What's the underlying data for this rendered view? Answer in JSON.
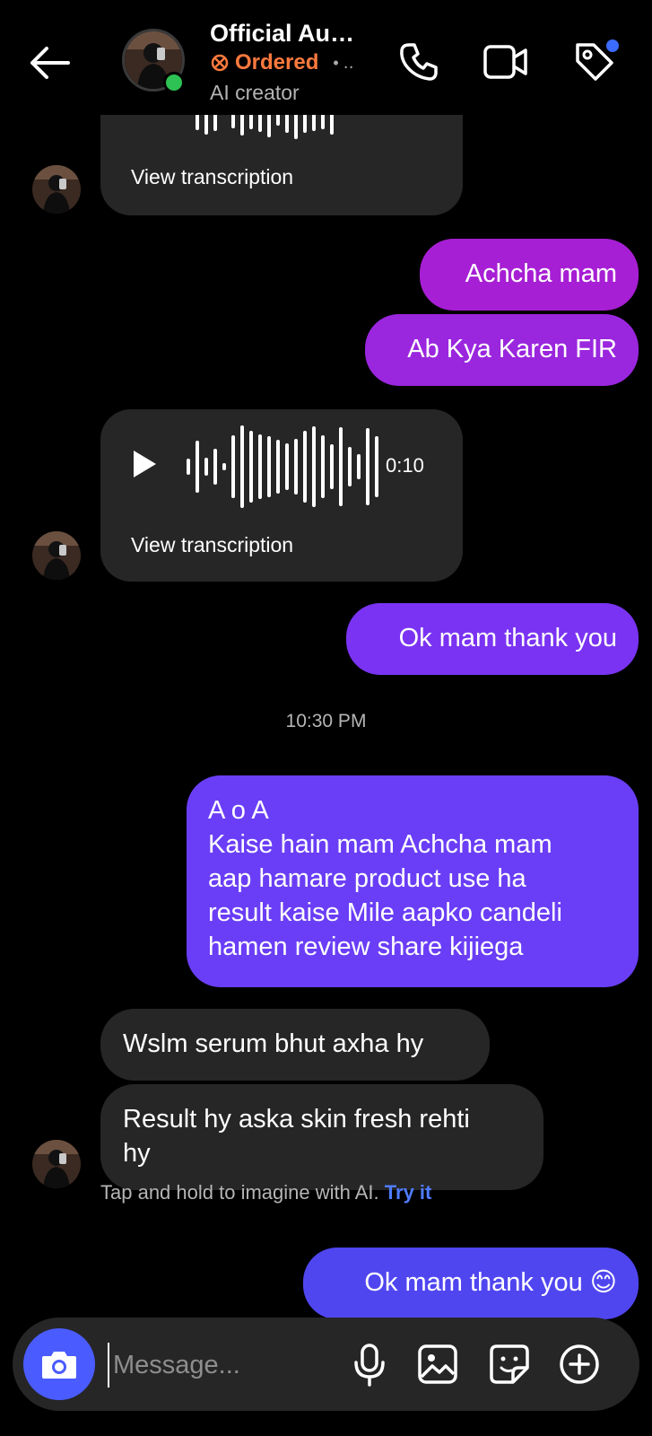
{
  "header": {
    "name": "Official Au…",
    "status": "Ordered",
    "status_more": "• ‥",
    "subtitle": "AI creator"
  },
  "icons": {
    "back": "arrow-left-icon",
    "call": "phone-icon",
    "video": "video-camera-icon",
    "tag": "tag-icon",
    "camera": "camera-icon",
    "mic": "microphone-icon",
    "gallery": "image-icon",
    "sticker": "sticker-icon",
    "plus": "plus-circle-icon"
  },
  "colors": {
    "accent_purple": "#a21fd6",
    "accent_violet": "#7a33f2",
    "accent_blue": "#5046f0",
    "online": "#2ec254",
    "status_orange": "#ff7a3d",
    "link_blue": "#4f7cff"
  },
  "messages": {
    "voice1_transcription": "View transcription",
    "out1": "Achcha mam",
    "out2": "Ab Kya Karen FIR",
    "voice2_duration": "0:10",
    "voice2_transcription": "View transcription",
    "out3": "Ok mam thank you",
    "timestamp": "10:30 PM",
    "out4_line1": "A o A",
    "out4_line2": "Kaise hain mam Achcha mam",
    "out4_line3": "aap hamare product use ha",
    "out4_line4": "result kaise Mile aapko candeli",
    "out4_line5": "hamen review share kijiega",
    "in1": "Wslm serum bhut axha hy",
    "in2_line1": "Result hy aska skin fresh rehti",
    "in2_line2": "hy",
    "hint_text": "Tap and hold to imagine with AI.",
    "hint_link": "Try it",
    "out5": "Ok mam thank you 😊"
  },
  "composer": {
    "placeholder": "Message..."
  }
}
